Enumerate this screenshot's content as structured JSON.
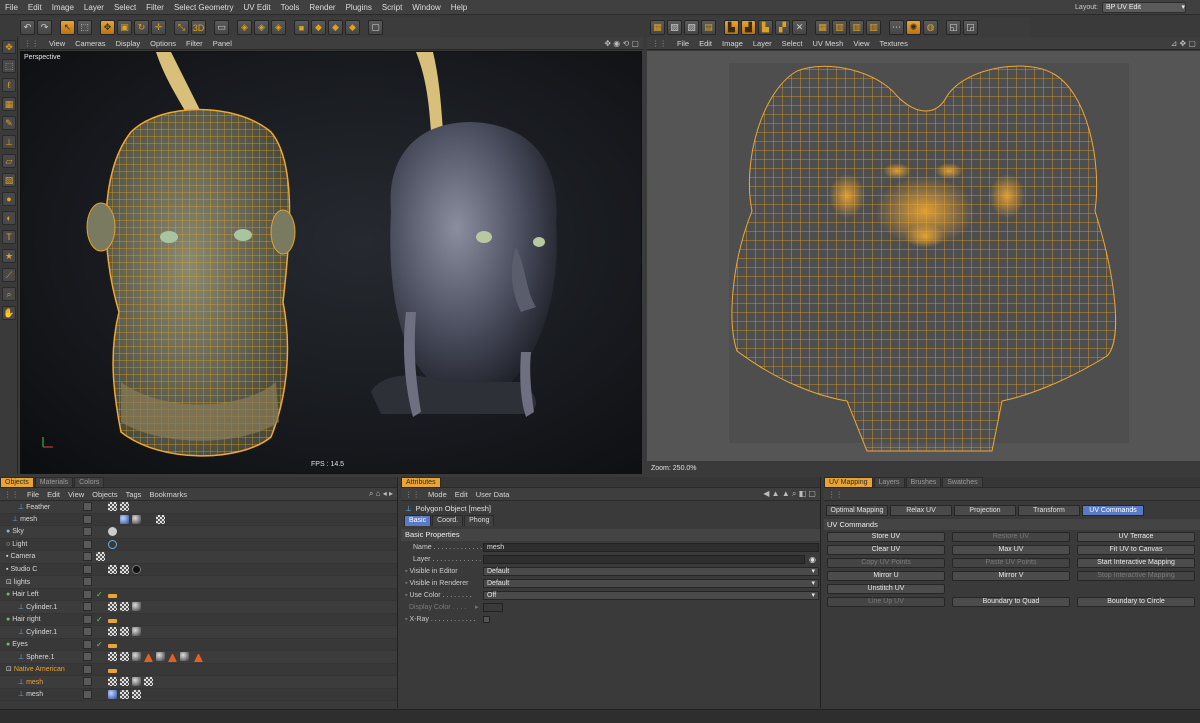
{
  "menubar": {
    "items": [
      "File",
      "Edit",
      "Image",
      "Layer",
      "Select",
      "Filter",
      "Select Geometry",
      "UV Edit",
      "Tools",
      "Render",
      "Plugins",
      "Script",
      "Window",
      "Help"
    ],
    "layout_label": "Layout:",
    "layout_value": "BP UV Edit"
  },
  "viewport": {
    "menu": [
      "View",
      "Cameras",
      "Display",
      "Options",
      "Filter",
      "Panel"
    ],
    "label": "Perspective",
    "fps": "FPS : 14.5"
  },
  "uv_view": {
    "menu": [
      "File",
      "Edit",
      "Image",
      "Layer",
      "Select",
      "UV Mesh",
      "View",
      "Textures"
    ],
    "zoom": "Zoom: 250.0%"
  },
  "objects_panel": {
    "tabs": [
      "Objects",
      "Materials",
      "Colors"
    ],
    "menu": [
      "File",
      "Edit",
      "View",
      "Objects",
      "Tags",
      "Bookmarks"
    ],
    "rows": [
      {
        "name": "Feather",
        "indent": 2
      },
      {
        "name": "mesh",
        "indent": 1
      },
      {
        "name": "Sky",
        "indent": 0
      },
      {
        "name": "Light",
        "indent": 0
      },
      {
        "name": "Camera",
        "indent": 0
      },
      {
        "name": "Studio C",
        "indent": 0
      },
      {
        "name": "lights",
        "indent": 0
      },
      {
        "name": "Hair Left",
        "indent": 0
      },
      {
        "name": "Cylinder.1",
        "indent": 1
      },
      {
        "name": "Hair right",
        "indent": 0
      },
      {
        "name": "Cylinder.1",
        "indent": 1
      },
      {
        "name": "Eyes",
        "indent": 0
      },
      {
        "name": "Sphere.1",
        "indent": 1
      },
      {
        "name": "Native American",
        "indent": 0
      },
      {
        "name": "mesh",
        "indent": 1
      },
      {
        "name": "mesh",
        "indent": 1
      }
    ]
  },
  "attributes_panel": {
    "tab": "Attributes",
    "menu": [
      "Mode",
      "Edit",
      "User Data"
    ],
    "object_title": "Polygon Object [mesh]",
    "subtabs": [
      "Basic",
      "Coord.",
      "Phong"
    ],
    "section": "Basic Properties",
    "fields": {
      "name_label": "Name . . . . . . . . . . . . .",
      "name_value": "mesh",
      "layer_label": "Layer . . . . . . . . . . . . .",
      "vis_editor_label": "Visible in Editor",
      "vis_editor_value": "Default",
      "vis_renderer_label": "Visible in Renderer",
      "vis_renderer_value": "Default",
      "use_color_label": "Use Color . . . . . . . .",
      "use_color_value": "Off",
      "display_color_label": "Display Color . . . .",
      "xray_label": "X-Ray . . . . . . . . . . . ."
    }
  },
  "uv_mapping_panel": {
    "tabs": [
      "UV Mapping",
      "Layers",
      "Brushes",
      "Swatches"
    ],
    "subtabs": [
      "Optimal Mapping",
      "Relax UV",
      "Projection",
      "Transform",
      "UV Commands"
    ],
    "section": "UV Commands",
    "buttons": [
      [
        "Store UV",
        "Restore UV",
        "UV Terrace"
      ],
      [
        "Clear UV",
        "Max UV",
        "Fit UV to Canvas"
      ],
      [
        "Copy UV Points",
        "Paste UV Points",
        "Start Interactive Mapping"
      ],
      [
        "Mirror U",
        "Mirror V",
        "Stop Interactive Mapping"
      ],
      [
        "Unstitch UV",
        "",
        ""
      ],
      [
        "Line Up UV",
        "Boundary to Quad",
        "Boundary to Circle"
      ]
    ]
  }
}
